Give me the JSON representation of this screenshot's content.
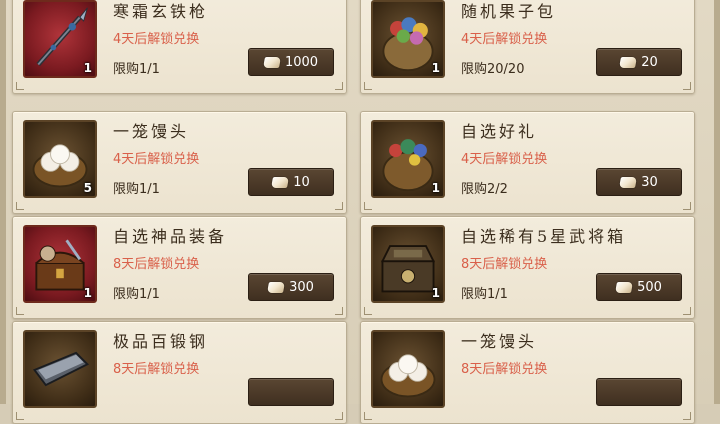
{
  "items": [
    {
      "name": "寒霜玄铁枪",
      "unlock": "4天后解锁兑换",
      "limit": "限购1/1",
      "qty": "1",
      "price": "1000",
      "thumb": "spear-icon",
      "bg": "red"
    },
    {
      "name": "随机果子包",
      "unlock": "4天后解锁兑换",
      "limit": "限购20/20",
      "qty": "1",
      "price": "20",
      "thumb": "fruit-bag-icon",
      "bg": "brown"
    },
    {
      "name": "一笼馒头",
      "unlock": "4天后解锁兑换",
      "limit": "限购1/1",
      "qty": "5",
      "price": "10",
      "thumb": "steamed-buns-icon",
      "bg": "brown"
    },
    {
      "name": "自选好礼",
      "unlock": "4天后解锁兑换",
      "limit": "限购2/2",
      "qty": "1",
      "price": "30",
      "thumb": "gift-bag-icon",
      "bg": "brown"
    },
    {
      "name": "自选神品装备",
      "unlock": "8天后解锁兑换",
      "limit": "限购1/1",
      "qty": "1",
      "price": "300",
      "thumb": "equipment-chest-icon",
      "bg": "red"
    },
    {
      "name": "自选稀有5星武将箱",
      "unlock": "8天后解锁兑换",
      "limit": "限购1/1",
      "qty": "1",
      "price": "500",
      "thumb": "general-chest-icon",
      "bg": "brown"
    },
    {
      "name": "极品百锻钢",
      "unlock": "8天后解锁兑换",
      "limit": "",
      "qty": "",
      "price": "",
      "thumb": "steel-ingot-icon",
      "bg": "brown"
    },
    {
      "name": "一笼馒头",
      "unlock": "8天后解锁兑换",
      "limit": "",
      "qty": "",
      "price": "",
      "thumb": "steamed-buns-icon",
      "bg": "brown"
    }
  ],
  "colors": {
    "unlock_text": "#d9604a",
    "button_bg": "#4b3926",
    "card_bg": "#f0e8d6"
  }
}
